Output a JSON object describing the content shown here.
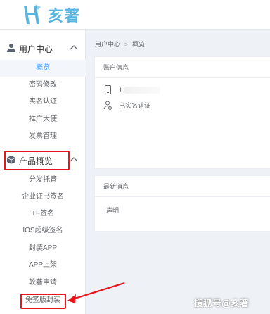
{
  "logo": {
    "mark": "H",
    "text": "亥著"
  },
  "sidebar": {
    "groups": [
      {
        "label": "用户中心",
        "icon": "user-icon"
      },
      {
        "label": "产品概览",
        "icon": "box-icon"
      }
    ],
    "user_items": [
      {
        "label": "概览",
        "active": true
      },
      {
        "label": "密码修改"
      },
      {
        "label": "实名认证"
      },
      {
        "label": "推广大使"
      },
      {
        "label": "发票管理"
      }
    ],
    "product_items": [
      {
        "label": "分发托管"
      },
      {
        "label": "企业证书签名"
      },
      {
        "label": "TF签名"
      },
      {
        "label": "IOS超级签名"
      },
      {
        "label": "封装APP"
      },
      {
        "label": "APP上架"
      },
      {
        "label": "软著申请"
      },
      {
        "label": "免签版封装"
      }
    ]
  },
  "breadcrumb": {
    "root": "用户中心",
    "separator": ">",
    "current": "概览"
  },
  "account_card": {
    "title": "账户信息",
    "phone_prefix": "1",
    "verify_status": "已实名认证"
  },
  "news_card": {
    "title": "最新消息",
    "statement": "声明"
  },
  "watermark": "搜狐号@亥著",
  "colors": {
    "accent": "#409eff",
    "highlight": "#e8151b",
    "logo": "#5ab4e0"
  }
}
